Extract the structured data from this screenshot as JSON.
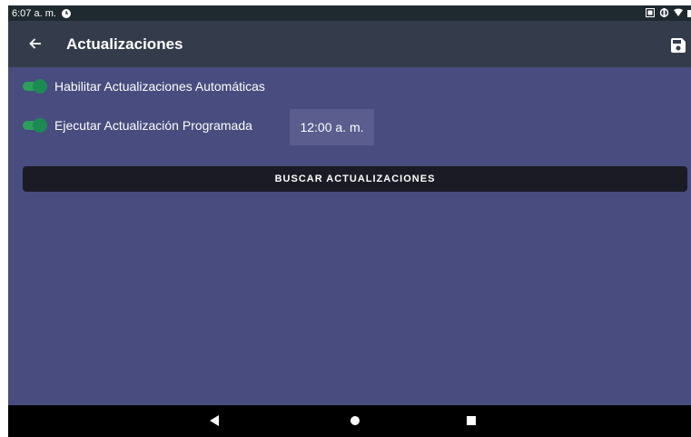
{
  "status_bar": {
    "time": "6:07 a. m."
  },
  "app_bar": {
    "title": "Actualizaciones"
  },
  "settings": {
    "auto_updates_label": "Habilitar Actualizaciones Automáticas",
    "auto_updates_enabled": true,
    "scheduled_update_label": "Ejecutar Actualización Programada",
    "scheduled_update_enabled": true,
    "scheduled_time": "12:00 a. m.",
    "search_button_label": "BUSCAR ACTUALIZACIONES"
  },
  "colors": {
    "accent_switch": "#2e9f5a",
    "background": "#484c7e",
    "app_bar": "#343c4c"
  },
  "icons": {
    "back": "arrow-left-icon",
    "save": "floppy-disk-icon",
    "status_clock": "clock-icon"
  }
}
